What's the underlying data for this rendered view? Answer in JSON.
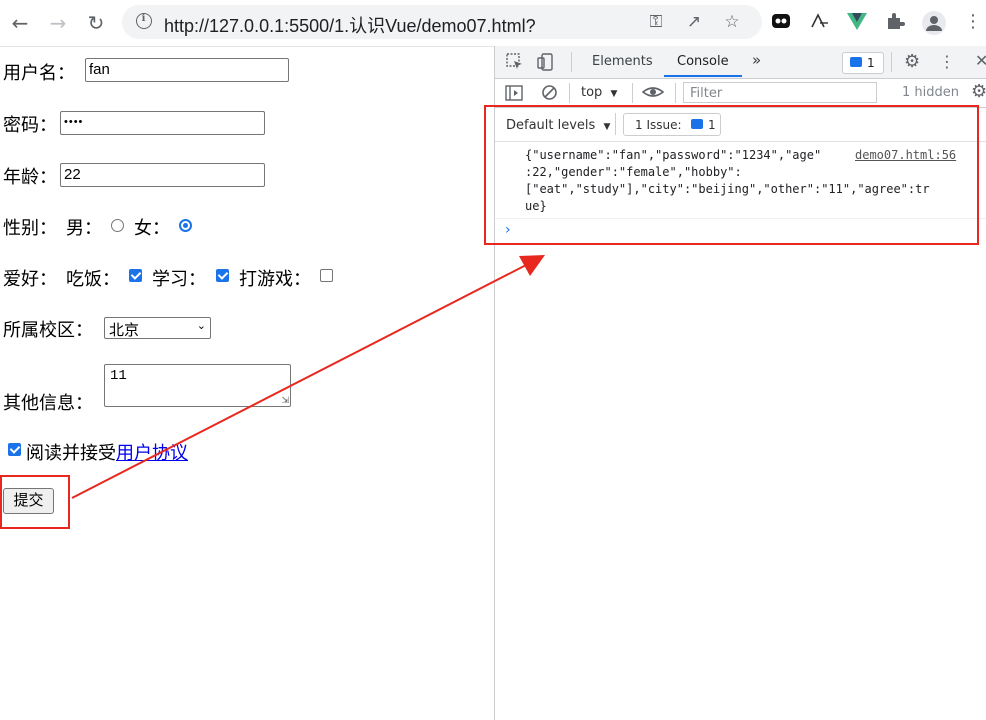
{
  "browser": {
    "url": "http://127.0.0.1:5500/1.认识Vue/demo07.html?"
  },
  "form": {
    "username_label": "用户名：",
    "username_value": "fan",
    "password_label": "密码：",
    "password_value": "••••",
    "age_label": "年龄：",
    "age_value": "22",
    "gender_label": "性别：",
    "gender_male": "男：",
    "gender_female": "女：",
    "hobby_label": "爱好：",
    "hobby_eat": "吃饭：",
    "hobby_study": "学习：",
    "hobby_game": "打游戏：",
    "campus_label": "所属校区：",
    "campus_selected": "北京",
    "other_label": "其他信息：",
    "other_value": "11",
    "agree_text": "阅读并接受",
    "agree_link": "用户协议",
    "submit_label": "提交"
  },
  "devtools": {
    "tab_elements": "Elements",
    "tab_console": "Console",
    "issues_badge": "1",
    "context": "top",
    "filter_placeholder": "Filter",
    "hidden_count": "1 hidden",
    "default_levels": "Default levels",
    "issues_label": "1 Issue:",
    "issues_count": "1",
    "log_line1": "{\"username\":\"fan\",\"password\":\"1234\",\"age\"",
    "log_line2": ":22,\"gender\":\"female\",\"hobby\":",
    "log_line3": "[\"eat\",\"study\"],\"city\":\"beijing\",\"other\":\"11\",\"agree\":tr",
    "log_line4": "ue}",
    "log_source": "demo07.html:56"
  },
  "colors": {
    "accent": "#1a73e8",
    "annotation_red": "#e8281e"
  }
}
